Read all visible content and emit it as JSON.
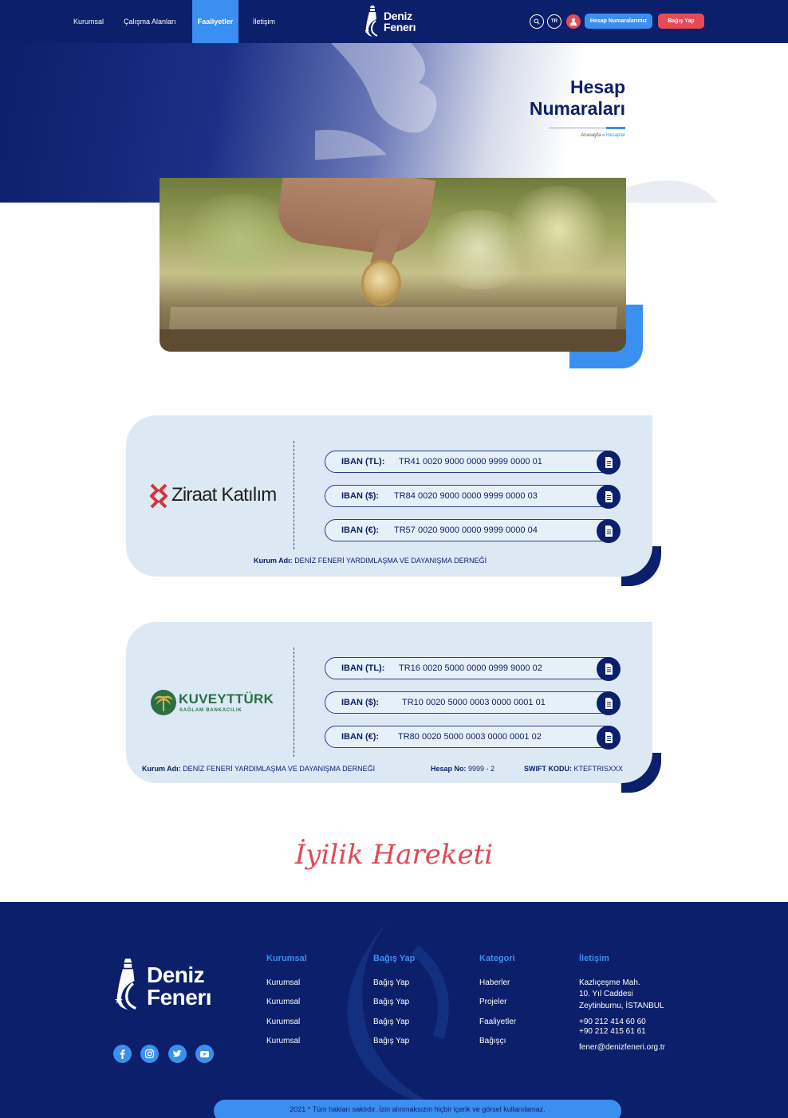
{
  "nav": {
    "items": [
      {
        "label": "Kurumsal"
      },
      {
        "label": "Çalışma Alanları"
      },
      {
        "label": "Faaliyetler"
      },
      {
        "label": "İletişim"
      }
    ],
    "active": "Faaliyetler",
    "logo_line1": "Deniz",
    "logo_line2": "Fener",
    "lang": "TR",
    "account_numbers_button": "Hesap Numaralarımız",
    "donate_button": "Bağış Yap",
    "accent_color": "#3b8ff0",
    "brand_color": "#0b1f6b",
    "cta_color": "#e84a55"
  },
  "hero": {
    "title_line1": "Hesap",
    "title_line2": "Numaraları",
    "breadcrumb_home": "Anasayfa",
    "breadcrumb_sep": "»",
    "breadcrumb_current": "Hesaplar"
  },
  "banks": [
    {
      "name": "Ziraat Katılım",
      "ibans": [
        {
          "label": "IBAN (TL):",
          "value": "TR41 0020 9000 0000 9999 0000 01"
        },
        {
          "label": "IBAN ($):",
          "value": "TR84 0020 9000 0000 9999 0000 03"
        },
        {
          "label": "IBAN (€):",
          "value": "TR57 0020 9000 0000 9999 0000 04"
        }
      ],
      "org_label": "Kurum Adı:",
      "org_value": "DENİZ FENERİ YARDIMLAŞMA VE DAYANIŞMA DERNEĞİ"
    },
    {
      "name": "KUVEYTTÜRK",
      "subtitle": "SAĞLAM BANKACILIK",
      "ibans": [
        {
          "label": "IBAN (TL):",
          "value": "TR16 0020 5000 0000 0999 9000 02"
        },
        {
          "label": "IBAN ($):",
          "value": "TR10 0020 5000 0003 0000 0001 01"
        },
        {
          "label": "IBAN (€):",
          "value": "TR80 0020 5000 0003 0000 0001 02"
        }
      ],
      "org_label": "Kurum Adı:",
      "org_value": "DENİZ FENERİ YARDIMLAŞMA VE DAYANIŞMA DERNEĞİ",
      "account_label": "Hesap No:",
      "account_value": "9999 - 2",
      "swift_label": "SWIFT KODU:",
      "swift_value": "KTEFTRISXXX"
    }
  ],
  "slogan": "İyilik Hareketi",
  "footer": {
    "logo_line1": "Deniz",
    "logo_line2": "Fener",
    "social": [
      "facebook-icon",
      "instagram-icon",
      "twitter-icon",
      "youtube-icon"
    ],
    "columns": [
      {
        "title": "Kurumsal",
        "items": [
          "Kurumsal",
          "Kurumsal",
          "Kurumsal",
          "Kurumsal"
        ]
      },
      {
        "title": "Bağış Yap",
        "items": [
          "Bağış Yap",
          "Bağış Yap",
          "Bağış Yap",
          "Bağış Yap"
        ]
      },
      {
        "title": "Kategori",
        "items": [
          "Haberler",
          "Projeler",
          "Faaliyetler",
          "Bağışçı"
        ]
      }
    ],
    "contact": {
      "title": "İletişim",
      "address1": "Kazlıçeşme Mah.",
      "address2": "10. Yıl Caddesi",
      "address3": "Zeytinburnu, İSTANBUL",
      "phone1": "+90 212 414 60 60",
      "phone2": "+90 212 415 61 61",
      "email": "fener@denizfeneri.org.tr"
    },
    "copyright": "2021 * Tüm hakları saklıdır. İzin alınmaksızın hiçbir içerik ve görsel kullanılamaz."
  }
}
